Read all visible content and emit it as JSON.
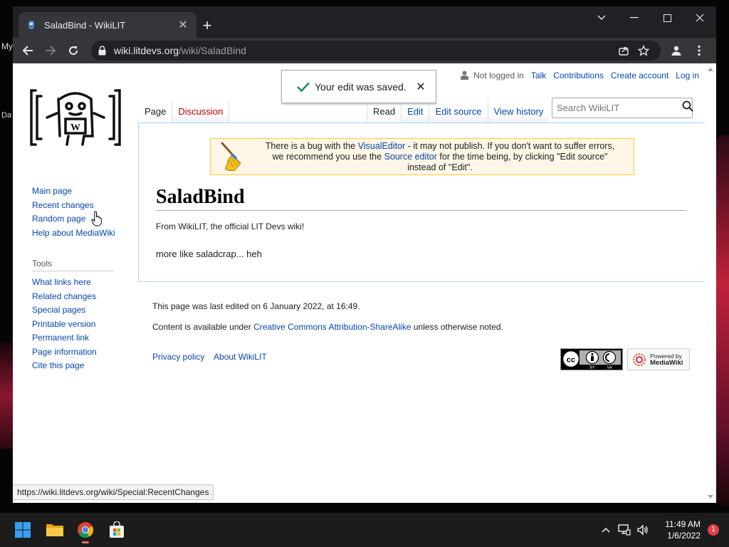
{
  "desktop": {
    "label_my": "My",
    "label_da": "Da"
  },
  "browser": {
    "tab": {
      "title": "SaladBind - WikiLIT",
      "close_icon": "close-icon"
    },
    "new_tab_icon": "plus-icon",
    "window_controls": [
      "chevron-down-icon",
      "minimize-icon",
      "maximize-icon",
      "close-icon"
    ],
    "address": {
      "host": "wiki.litdevs.org",
      "path": "/wiki/SaladBind"
    },
    "status_url": "https://wiki.litdevs.org/wiki/Special:RecentChanges"
  },
  "toast": {
    "message": "Your edit was saved.",
    "close": "✕"
  },
  "personal": {
    "not_logged_in": "Not logged in",
    "talk": "Talk",
    "contributions": "Contributions",
    "create_account": "Create account",
    "log_in": "Log in"
  },
  "page_tabs": {
    "page": "Page",
    "discussion": "Discussion",
    "read": "Read",
    "edit": "Edit",
    "edit_source": "Edit source",
    "view_history": "View history"
  },
  "search": {
    "placeholder": "Search WikiLIT"
  },
  "sidebar": {
    "navigation": [
      "Main page",
      "Recent changes",
      "Random page",
      "Help about MediaWiki"
    ],
    "tools_heading": "Tools",
    "tools": [
      "What links here",
      "Related changes",
      "Special pages",
      "Printable version",
      "Permanent link",
      "Page information",
      "Cite this page"
    ]
  },
  "notice": {
    "t1": "There is a bug with the ",
    "link1": "VisualEditor",
    "t2": " - it may not publish. If you don't want to suffer errors, we recommend you use the ",
    "link2": "Source editor",
    "t3": " for the time being, by clicking \"Edit source\" instead of \"Edit\"."
  },
  "article": {
    "title": "SaladBind",
    "tagline": "From WikiLIT, the official LIT Devs wiki!",
    "body": "more like saladcrap... heh"
  },
  "footer": {
    "last_edited": "This page was last edited on 6 January 2022, at 16:49.",
    "license_pre": "Content is available under ",
    "license_link": "Creative Commons Attribution-ShareAlike",
    "license_post": " unless otherwise noted.",
    "privacy": "Privacy policy",
    "about": "About WikiLIT",
    "powered_by": "Powered by",
    "mediawiki": "MediaWiki"
  },
  "taskbar": {
    "time": "11:49 AM",
    "date": "1/6/2022",
    "notifications": "1"
  },
  "colors": {
    "link": "#0645ad",
    "red_link": "#ba0000",
    "notice_bg": "#fef6e7",
    "notice_border": "#ffcc33"
  }
}
